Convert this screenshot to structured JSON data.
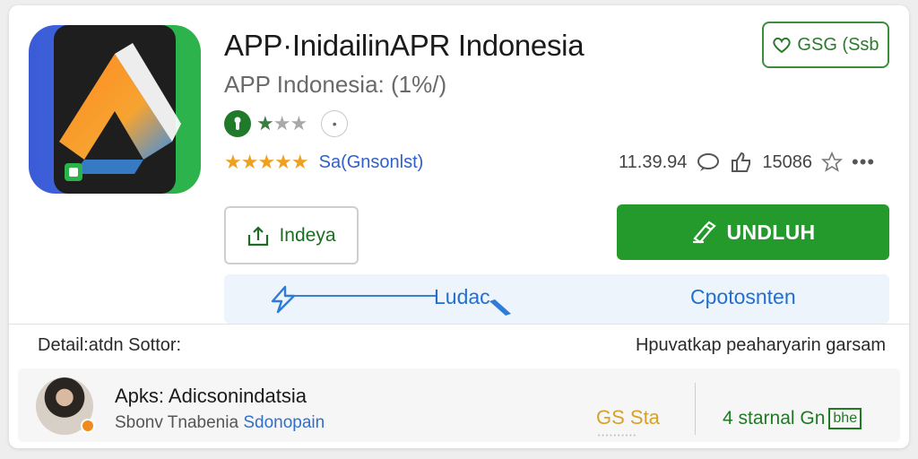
{
  "app": {
    "title": "APP·InidailinAPR Indonesia",
    "subtitle": "APP Indonesia: (1%/)",
    "rating_label": "Sa(Gnsonlst)",
    "icon": "app-logo-icon"
  },
  "follow_button": {
    "label": "GSG (Ssb",
    "icon": "heart-icon"
  },
  "stats": {
    "downloads": "11.39.94",
    "likes": "15086",
    "icons": [
      "chat-icon",
      "thumbs-up-icon",
      "star-outline-icon",
      "more-icon"
    ]
  },
  "actions": {
    "secondary_label": "Indeya",
    "primary_label": "UNDLUH"
  },
  "tabs": [
    {
      "label": "Ludac"
    },
    {
      "label": "Cpotosnten"
    }
  ],
  "section": {
    "left": "Detail:atdn Sottor:",
    "right": "Hpuvatkap peaharyarin garsam"
  },
  "developer": {
    "name": "Apks: Adicsonindatsia",
    "sub": "Sbonv Tnabenia",
    "sub_link": "Sdonopain",
    "badge": "GS Sta",
    "stat_text": "4 starnal Gn",
    "stat_box": "bhe"
  },
  "colors": {
    "primary_green": "#239a2b",
    "link_blue": "#2170d0",
    "star_orange": "#f0a020"
  }
}
